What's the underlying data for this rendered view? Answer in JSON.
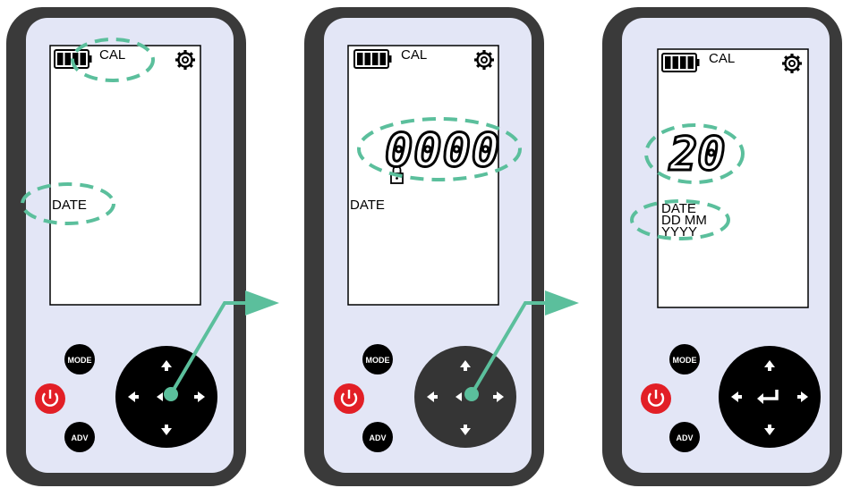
{
  "devices": [
    {
      "cal_label": "CAL",
      "date_label": "DATE",
      "reading": "",
      "buttons": {
        "mode": "MODE",
        "adv": "ADV"
      }
    },
    {
      "cal_label": "CAL",
      "date_label": "DATE",
      "reading": "0000",
      "buttons": {
        "mode": "MODE",
        "adv": "ADV"
      }
    },
    {
      "cal_label": "CAL",
      "date_label": "DATE",
      "date_format_line1": "DD MM",
      "date_format_line2": "YYYY",
      "reading": "20",
      "buttons": {
        "mode": "MODE",
        "adv": "ADV"
      }
    }
  ],
  "colors": {
    "body": "#3a3a3a",
    "panel": "#e3e6f6",
    "highlight": "#5bbf9c",
    "power": "#e21f26"
  },
  "icons": [
    "battery-icon",
    "gear-icon",
    "lock-icon",
    "power-icon",
    "arrow-up-icon",
    "arrow-down-icon",
    "arrow-left-icon",
    "arrow-right-icon",
    "enter-icon"
  ]
}
